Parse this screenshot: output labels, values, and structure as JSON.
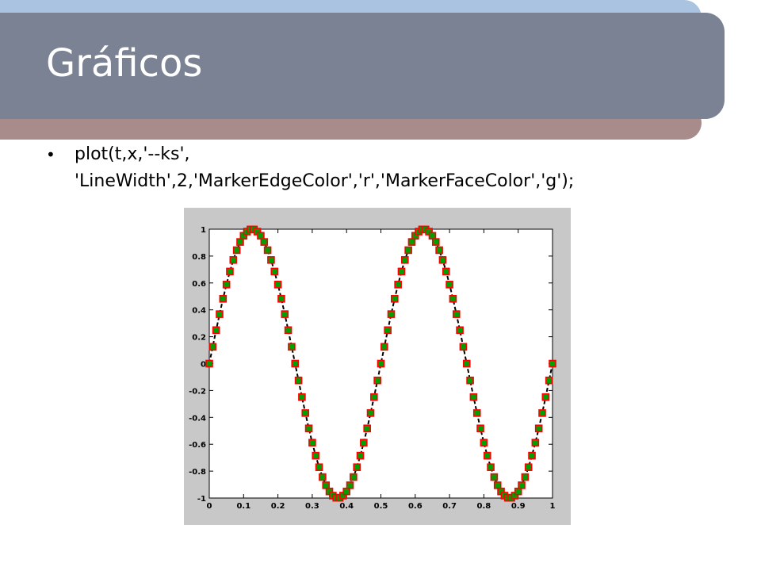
{
  "slide": {
    "title": "Gráficos",
    "bullet": "plot(t,x,'--ks',\n'LineWidth',2,'MarkerEdgeColor','r','MarkerFaceColor','g');"
  },
  "colors": {
    "title_band": "#7a8293",
    "top_band": "#a9c3e0",
    "bottom_band": "#a88b8b",
    "figure_bg": "#c8c8c8",
    "marker_edge": "#ff0000",
    "marker_face": "#00a000",
    "line": "#000000"
  },
  "chart_data": {
    "type": "line",
    "line_style": "dashed",
    "marker": "square",
    "series": [
      {
        "x": [
          0,
          0.01,
          0.02,
          0.03,
          0.04,
          0.05,
          0.06,
          0.07,
          0.08,
          0.09,
          0.1,
          0.11,
          0.12,
          0.13,
          0.14,
          0.15,
          0.16,
          0.17,
          0.18,
          0.19,
          0.2,
          0.21,
          0.22,
          0.23,
          0.24,
          0.25,
          0.26,
          0.27,
          0.28,
          0.29,
          0.3,
          0.31,
          0.32,
          0.33,
          0.34,
          0.35,
          0.36,
          0.37,
          0.38,
          0.39,
          0.4,
          0.41,
          0.42,
          0.43,
          0.44,
          0.45,
          0.46,
          0.47,
          0.48,
          0.49,
          0.5,
          0.51,
          0.52,
          0.53,
          0.54,
          0.55,
          0.56,
          0.57,
          0.58,
          0.59,
          0.6,
          0.61,
          0.62,
          0.63,
          0.64,
          0.65,
          0.66,
          0.67,
          0.68,
          0.69,
          0.7,
          0.71,
          0.72,
          0.73,
          0.74,
          0.75,
          0.76,
          0.77,
          0.78,
          0.79,
          0.8,
          0.81,
          0.82,
          0.83,
          0.84,
          0.85,
          0.86,
          0.87,
          0.88,
          0.89,
          0.9,
          0.91,
          0.92,
          0.93,
          0.94,
          0.95,
          0.96,
          0.97,
          0.98,
          0.99,
          1.0
        ],
        "y": [
          0,
          0.125,
          0.249,
          0.368,
          0.482,
          0.588,
          0.685,
          0.771,
          0.844,
          0.905,
          0.951,
          0.982,
          0.998,
          0.998,
          0.982,
          0.951,
          0.905,
          0.844,
          0.771,
          0.685,
          0.588,
          0.482,
          0.368,
          0.249,
          0.125,
          0,
          -0.125,
          -0.249,
          -0.368,
          -0.482,
          -0.588,
          -0.685,
          -0.771,
          -0.844,
          -0.905,
          -0.951,
          -0.982,
          -0.998,
          -0.998,
          -0.982,
          -0.951,
          -0.905,
          -0.844,
          -0.771,
          -0.685,
          -0.588,
          -0.482,
          -0.368,
          -0.249,
          -0.125,
          0,
          0.125,
          0.249,
          0.368,
          0.482,
          0.588,
          0.685,
          0.771,
          0.844,
          0.905,
          0.951,
          0.982,
          0.998,
          0.998,
          0.982,
          0.951,
          0.905,
          0.844,
          0.771,
          0.685,
          0.588,
          0.482,
          0.368,
          0.249,
          0.125,
          0,
          -0.125,
          -0.249,
          -0.368,
          -0.482,
          -0.588,
          -0.685,
          -0.771,
          -0.844,
          -0.905,
          -0.951,
          -0.982,
          -0.998,
          -0.998,
          -0.982,
          -0.951,
          -0.905,
          -0.844,
          -0.771,
          -0.685,
          -0.588,
          -0.482,
          -0.368,
          -0.249,
          -0.125,
          0
        ]
      }
    ],
    "xlim": [
      0,
      1
    ],
    "ylim": [
      -1,
      1
    ],
    "xticks": [
      "0",
      "0.1",
      "0.2",
      "0.3",
      "0.4",
      "0.5",
      "0.6",
      "0.7",
      "0.8",
      "0.9",
      "1"
    ],
    "xtick_values": [
      0,
      0.1,
      0.2,
      0.3,
      0.4,
      0.5,
      0.6,
      0.7,
      0.8,
      0.9,
      1
    ],
    "yticks": [
      "1",
      "0.8",
      "0.6",
      "0.4",
      "0.2",
      "0",
      "-0.2",
      "-0.4",
      "-0.6",
      "-0.8",
      "-1"
    ],
    "ytick_values": [
      1,
      0.8,
      0.6,
      0.4,
      0.2,
      0,
      -0.2,
      -0.4,
      -0.6,
      -0.8,
      -1
    ],
    "grid": false
  }
}
